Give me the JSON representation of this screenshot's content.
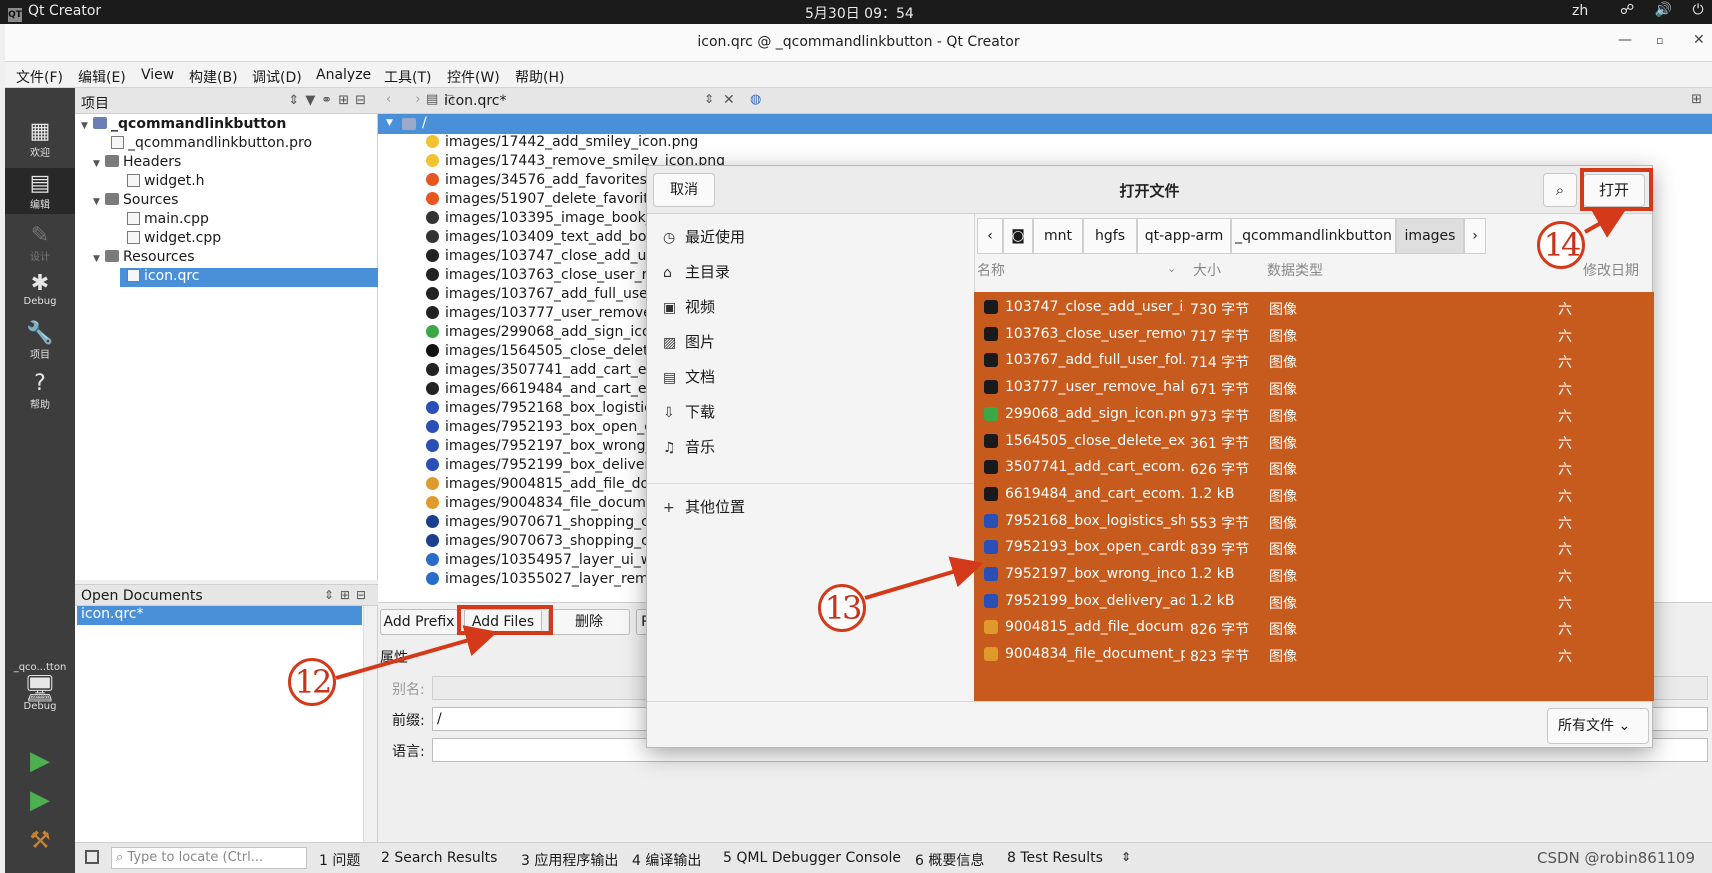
{
  "system_bar": {
    "app_name": "Qt Creator",
    "app_logo": "QT",
    "clock": "5月30日  09：54",
    "lang": "zh",
    "icons": "☍ 🔊 ⏻"
  },
  "window": {
    "title": "icon.qrc @ _qcommandlinkbutton - Qt Creator"
  },
  "menu": [
    "文件(F)",
    "编辑(E)",
    "View",
    "构建(B)",
    "调试(D)",
    "Analyze",
    "工具(T)",
    "控件(W)",
    "帮助(H)"
  ],
  "modes": [
    {
      "icon": "grid-icon",
      "glyph": "▦",
      "label": "欢迎"
    },
    {
      "icon": "edit-icon",
      "glyph": "▤",
      "label": "编辑"
    },
    {
      "icon": "design-icon",
      "glyph": "✎",
      "label": "设计"
    },
    {
      "icon": "bug-icon",
      "glyph": "✱",
      "label": "Debug"
    },
    {
      "icon": "wrench-icon",
      "glyph": "🔧",
      "label": "项目"
    },
    {
      "icon": "help-icon",
      "glyph": "?",
      "label": "帮助"
    }
  ],
  "kit": {
    "project": "_qco...tton",
    "mode": "Debug"
  },
  "project_panel": {
    "title": "项目",
    "tree": [
      {
        "label": "_qcommandlinkbutton",
        "level": 0,
        "kind": "project",
        "expanded": true
      },
      {
        "label": "_qcommandlinkbutton.pro",
        "level": 1,
        "kind": "file"
      },
      {
        "label": "Headers",
        "level": 1,
        "kind": "folder",
        "expanded": true
      },
      {
        "label": "widget.h",
        "level": 2,
        "kind": "file"
      },
      {
        "label": "Sources",
        "level": 1,
        "kind": "folder",
        "expanded": true
      },
      {
        "label": "main.cpp",
        "level": 2,
        "kind": "file"
      },
      {
        "label": "widget.cpp",
        "level": 2,
        "kind": "file"
      },
      {
        "label": "Resources",
        "level": 1,
        "kind": "folder",
        "expanded": true
      },
      {
        "label": "icon.qrc",
        "level": 2,
        "kind": "file",
        "selected": true
      }
    ]
  },
  "open_documents": {
    "title": "Open Documents",
    "items": [
      "icon.qrc*"
    ]
  },
  "editor": {
    "tab": "icon.qrc*",
    "root_prefix": "/",
    "resources": [
      {
        "name": "images/17442_add_smiley_icon.png",
        "color": "#f2c230"
      },
      {
        "name": "images/17443_remove_smiley_icon.png",
        "color": "#f2c230"
      },
      {
        "name": "images/34576_add_favorites_",
        "color": "#e6561e"
      },
      {
        "name": "images/51907_delete_favorit",
        "color": "#e6561e"
      },
      {
        "name": "images/103395_image_book_",
        "color": "#333333"
      },
      {
        "name": "images/103409_text_add_boo",
        "color": "#333333"
      },
      {
        "name": "images/103747_close_add_us",
        "color": "#222222"
      },
      {
        "name": "images/103763_close_user_re",
        "color": "#222222"
      },
      {
        "name": "images/103767_add_full_user",
        "color": "#222222"
      },
      {
        "name": "images/103777_user_remove_",
        "color": "#222222"
      },
      {
        "name": "images/299068_add_sign_ico",
        "color": "#3aa845"
      },
      {
        "name": "images/1564505_close_delete",
        "color": "#111111"
      },
      {
        "name": "images/3507741_add_cart_ec",
        "color": "#222222"
      },
      {
        "name": "images/6619484_and_cart_ec",
        "color": "#222222"
      },
      {
        "name": "images/7952168_box_logistic",
        "color": "#2a4fb5"
      },
      {
        "name": "images/7952193_box_open_c",
        "color": "#2a4fb5"
      },
      {
        "name": "images/7952197_box_wrong_",
        "color": "#2a4fb5"
      },
      {
        "name": "images/7952199_box_deliver",
        "color": "#2a4fb5"
      },
      {
        "name": "images/9004815_add_file_do",
        "color": "#e09a2c"
      },
      {
        "name": "images/9004834_file_docume",
        "color": "#e09a2c"
      },
      {
        "name": "images/9070671_shopping_c",
        "color": "#1d3f8f"
      },
      {
        "name": "images/9070673_shopping_c",
        "color": "#1d3f8f"
      },
      {
        "name": "images/10354957_layer_ui_w",
        "color": "#2a6cc9"
      },
      {
        "name": "images/10355027_layer_remo",
        "color": "#2a6cc9"
      }
    ],
    "buttons": {
      "add_prefix": "Add Prefix",
      "add_files": "Add Files",
      "remove": "删除",
      "more": "R"
    },
    "properties": {
      "title": "属性",
      "alias_label": "别名:",
      "alias_value": "",
      "prefix_label": "前缀:",
      "prefix_value": "/",
      "lang_label": "语言:",
      "lang_value": ""
    }
  },
  "dialog": {
    "title": "打开文件",
    "cancel": "取消",
    "open": "打开",
    "search_glyph": "⌕",
    "places": [
      {
        "icon": "clock-icon",
        "glyph": "◷",
        "label": "最近使用"
      },
      {
        "icon": "home-icon",
        "glyph": "⌂",
        "label": "主目录"
      },
      {
        "icon": "video-icon",
        "glyph": "▣",
        "label": "视频"
      },
      {
        "icon": "picture-icon",
        "glyph": "▨",
        "label": "图片"
      },
      {
        "icon": "document-icon",
        "glyph": "▤",
        "label": "文档"
      },
      {
        "icon": "download-icon",
        "glyph": "⇩",
        "label": "下载"
      },
      {
        "icon": "music-icon",
        "glyph": "♫",
        "label": "音乐"
      }
    ],
    "other_places": "其他位置",
    "other_glyph": "+",
    "path": [
      "mnt",
      "hgfs",
      "qt-app-arm",
      "_qcommandlinkbutton",
      "images"
    ],
    "columns": {
      "name": "名称",
      "size": "大小",
      "type": "数据类型",
      "modified": "修改日期"
    },
    "files": [
      {
        "name": "103747_close_add_user_i...",
        "size": "730 字节",
        "type": "图像",
        "modified": "六",
        "color": "#1a1a1a"
      },
      {
        "name": "103763_close_user_remov...",
        "size": "717 字节",
        "type": "图像",
        "modified": "六",
        "color": "#1a1a1a"
      },
      {
        "name": "103767_add_full_user_fol...",
        "size": "714 字节",
        "type": "图像",
        "modified": "六",
        "color": "#1a1a1a"
      },
      {
        "name": "103777_user_remove_half...",
        "size": "671 字节",
        "type": "图像",
        "modified": "六",
        "color": "#1a1a1a"
      },
      {
        "name": "299068_add_sign_icon.png",
        "size": "973 字节",
        "type": "图像",
        "modified": "六",
        "color": "#3aa845"
      },
      {
        "name": "1564505_close_delete_exi...",
        "size": "361 字节",
        "type": "图像",
        "modified": "六",
        "color": "#1a1a1a"
      },
      {
        "name": "3507741_add_cart_ecom...",
        "size": "626 字节",
        "type": "图像",
        "modified": "六",
        "color": "#1a1a1a"
      },
      {
        "name": "6619484_and_cart_ecom...",
        "size": "1.2 kB",
        "type": "图像",
        "modified": "六",
        "color": "#1a1a1a"
      },
      {
        "name": "7952168_box_logistics_sh...",
        "size": "553 字节",
        "type": "图像",
        "modified": "六",
        "color": "#2a4fb5"
      },
      {
        "name": "7952193_box_open_cardb...",
        "size": "839 字节",
        "type": "图像",
        "modified": "六",
        "color": "#2a4fb5"
      },
      {
        "name": "7952197_box_wrong_inco...",
        "size": "1.2 kB",
        "type": "图像",
        "modified": "六",
        "color": "#2a4fb5"
      },
      {
        "name": "7952199_box_delivery_ad...",
        "size": "1.2 kB",
        "type": "图像",
        "modified": "六",
        "color": "#2a4fb5"
      },
      {
        "name": "9004815_add_file_docum...",
        "size": "826 字节",
        "type": "图像",
        "modified": "六",
        "color": "#e09a2c"
      },
      {
        "name": "9004834_file_document_p...",
        "size": "823 字节",
        "type": "图像",
        "modified": "六",
        "color": "#e09a2c"
      }
    ],
    "filter": "所有文件 ⌄"
  },
  "status_bar": {
    "locator_placeholder": "Type to locate (Ctrl...",
    "panes": [
      "1 问题",
      "2 Search Results",
      "3 应用程序输出",
      "4 编译输出",
      "5 QML Debugger Console",
      "6 概要信息",
      "8 Test Results"
    ]
  },
  "annotations": [
    "12",
    "13",
    "14"
  ],
  "watermark": "CSDN @robin861109",
  "colors": {
    "selection": "#4a90d9",
    "dialog_selection": "#c75b1d",
    "annotation": "#d43a1a"
  }
}
